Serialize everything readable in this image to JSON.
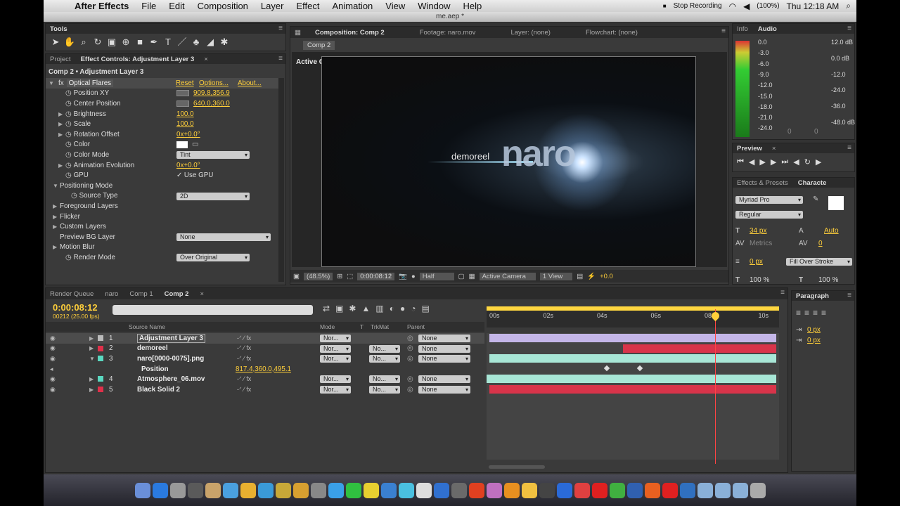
{
  "menubar": {
    "app": "After Effects",
    "items": [
      "File",
      "Edit",
      "Composition",
      "Layer",
      "Effect",
      "Animation",
      "View",
      "Window",
      "Help"
    ],
    "stop_recording": "Stop Recording",
    "battery": "(100%)",
    "clock": "Thu 12:18 AM"
  },
  "window_title": "me.aep *",
  "tools": {
    "title": "Tools"
  },
  "effect_controls": {
    "tab_project": "Project",
    "tab": "Effect Controls: Adjustment Layer 3",
    "breadcrumb": "Comp 2 • Adjustment Layer 3",
    "effect": "Optical Flares",
    "reset": "Reset",
    "options": "Options...",
    "about": "About...",
    "props": [
      {
        "name": "Position XY",
        "value": "909.8,356.9"
      },
      {
        "name": "Center Position",
        "value": "640.0,360.0"
      },
      {
        "name": "Brightness",
        "value": "100.0"
      },
      {
        "name": "Scale",
        "value": "100.0"
      },
      {
        "name": "Rotation Offset",
        "value": "0x+0.0°"
      },
      {
        "name": "Color",
        "value": ""
      },
      {
        "name": "Color Mode",
        "value": "Tint"
      },
      {
        "name": "Animation Evolution",
        "value": "0x+0.0°"
      },
      {
        "name": "GPU",
        "value": "Use GPU"
      },
      {
        "name": "Positioning Mode",
        "value": ""
      },
      {
        "name": "Source Type",
        "value": "2D"
      },
      {
        "name": "Foreground Layers",
        "value": ""
      },
      {
        "name": "Flicker",
        "value": ""
      },
      {
        "name": "Custom Layers",
        "value": ""
      },
      {
        "name": "Preview BG Layer",
        "value": "None"
      },
      {
        "name": "Motion Blur",
        "value": ""
      },
      {
        "name": "Render Mode",
        "value": "Over Original"
      }
    ]
  },
  "comp_viewer": {
    "tab_comp": "Composition: Comp 2",
    "tab_footage": "Footage: naro.mov",
    "tab_layer": "Layer: (none)",
    "tab_flow": "Flowchart: (none)",
    "sub_tab": "Comp 2",
    "active_camera": "Active Camera",
    "overlay_small": "demoreel",
    "overlay_big": "naro",
    "footer": {
      "zoom": "(48.5%)",
      "time": "0:00:08:12",
      "res": "Half",
      "camera": "Active Camera",
      "view": "1 View",
      "offset": "+0.0"
    }
  },
  "info": {
    "tab_info": "Info",
    "tab_audio": "Audio",
    "left_scale": [
      "0.0",
      "-3.0",
      "-6.0",
      "-9.0",
      "-12.0",
      "-15.0",
      "-18.0",
      "-21.0",
      "-24.0"
    ],
    "right_scale": [
      "12.0 dB",
      "0.0 dB",
      "-12.0",
      "-24.0",
      "-36.0",
      "-48.0 dB"
    ],
    "zeros": [
      "0",
      "0"
    ]
  },
  "preview": {
    "title": "Preview"
  },
  "character": {
    "tab_fx": "Effects & Presets",
    "tab_char": "Characte",
    "font": "Myriad Pro",
    "style": "Regular",
    "size": "34 px",
    "leading": "Auto",
    "kerning": "Metrics",
    "tracking": "0",
    "stroke": "0 px",
    "stroke_mode": "Fill Over Stroke",
    "vscale": "100 %",
    "hscale": "100 %"
  },
  "paragraph": {
    "title": "Paragraph",
    "indent1": "0 px",
    "indent2": "0 px"
  },
  "timeline": {
    "tab_render": "Render Queue",
    "tab_naro": "naro",
    "tab_comp1": "Comp 1",
    "tab_comp2": "Comp 2",
    "time": "0:00:08:12",
    "frames": "00212 (25.00 fps)",
    "headers": {
      "source": "Source Name",
      "mode": "Mode",
      "t": "T",
      "trkmat": "TrkMat",
      "parent": "Parent"
    },
    "ruler": [
      "00s",
      "02s",
      "04s",
      "06s",
      "08s",
      "10s"
    ],
    "layers": [
      {
        "num": "1",
        "name": "Adjustment Layer 3",
        "mode": "Nor...",
        "trkmat": "",
        "parent": "None",
        "color": "#bbbbbb"
      },
      {
        "num": "2",
        "name": "demoreel",
        "mode": "Nor...",
        "trkmat": "No...",
        "parent": "None",
        "color": "#e0304a"
      },
      {
        "num": "3",
        "name": "naro[0000-0075].png",
        "mode": "Nor...",
        "trkmat": "No...",
        "parent": "None",
        "color": "#5ad8c0"
      },
      {
        "num": "",
        "name": "Position",
        "mode": "817.4,360.0,495.1",
        "trkmat": "",
        "parent": "",
        "color": ""
      },
      {
        "num": "4",
        "name": "Atmosphere_06.mov",
        "mode": "Nor...",
        "trkmat": "No...",
        "parent": "None",
        "color": "#5ad8c0"
      },
      {
        "num": "5",
        "name": "Black Solid 2",
        "mode": "Nor...",
        "trkmat": "No...",
        "parent": "None",
        "color": "#e0304a"
      }
    ]
  },
  "colors": {
    "accent": "#ffcf3a",
    "adjust_bar": "#c4b6e8",
    "red_bar": "#d8344a",
    "teal_bar": "#a8e6d6",
    "cti": "#ff4444"
  }
}
